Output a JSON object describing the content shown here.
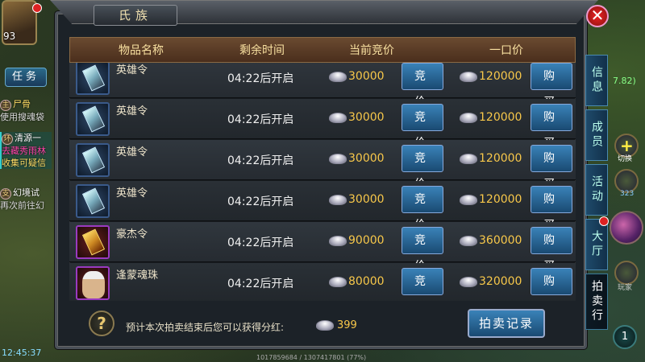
{
  "hud": {
    "level": "93",
    "task_tab": "任务",
    "quests": [
      {
        "tag": "主",
        "title": "尸骨",
        "detail": "使用搜魂袋"
      },
      {
        "tag": "环",
        "title": "清源一",
        "detail": "去藏秀雨林",
        "extra": "收集可疑信"
      },
      {
        "tag": "支",
        "title": "幻境试",
        "detail": "再次前往幻"
      }
    ],
    "clock": "12:45:37",
    "debug_text": "1017859684 / 1307417801 (77%)",
    "coord": "7.82)",
    "switch_label": "切换",
    "sword_count": "323",
    "player_label": "玩家",
    "corner_badge": "1"
  },
  "dialog": {
    "title": "氏族",
    "close": "✕",
    "columns": [
      "物品名称",
      "剩余时间",
      "当前竞价",
      "一口价"
    ],
    "bid_label": "竞 价",
    "buy_label": "购 买",
    "rows": [
      {
        "name": "英雄令",
        "time": "04:22后开启",
        "bid": "30000",
        "buyout": "120000",
        "icon": "hero-token-icon"
      },
      {
        "name": "英雄令",
        "time": "04:22后开启",
        "bid": "30000",
        "buyout": "120000",
        "icon": "hero-token-icon"
      },
      {
        "name": "英雄令",
        "time": "04:22后开启",
        "bid": "30000",
        "buyout": "120000",
        "icon": "hero-token-icon"
      },
      {
        "name": "英雄令",
        "time": "04:22后开启",
        "bid": "30000",
        "buyout": "120000",
        "icon": "hero-token-icon"
      },
      {
        "name": "豪杰令",
        "time": "04:22后开启",
        "bid": "90000",
        "buyout": "360000",
        "icon": "champion-token-icon"
      },
      {
        "name": "逢蒙魂珠",
        "time": "04:22后开启",
        "bid": "80000",
        "buyout": "320000",
        "icon": "soul-orb-portrait-icon"
      }
    ],
    "side_tabs": [
      "信息",
      "成员",
      "活动",
      "大厅",
      "拍卖行"
    ],
    "footer_text": "预计本次拍卖结束后您可以获得分红:",
    "footer_value": "399",
    "record_button": "拍卖记录"
  }
}
